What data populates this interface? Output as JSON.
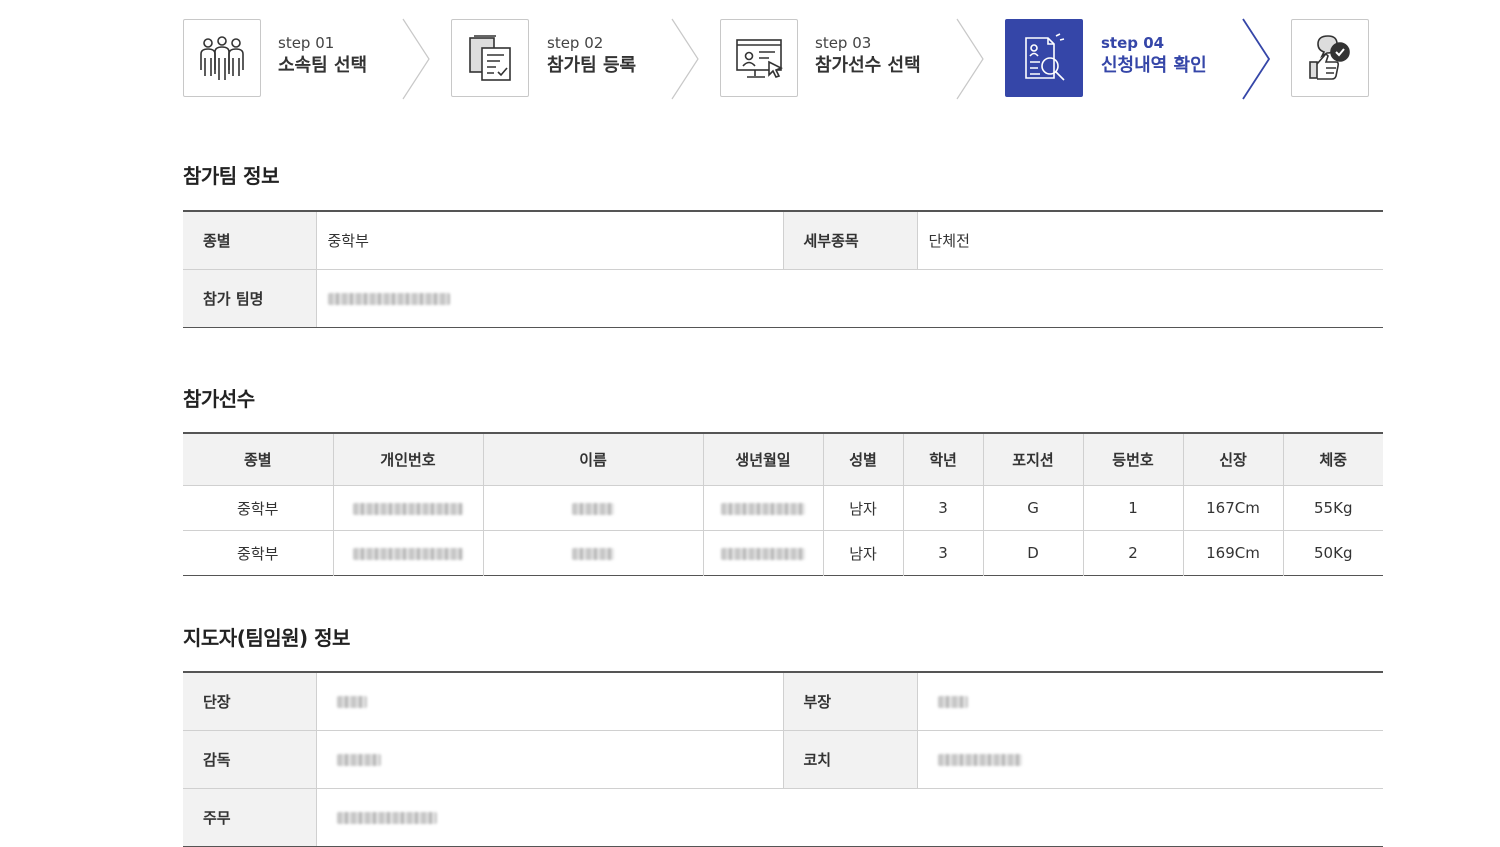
{
  "steps": [
    {
      "num": "step 01",
      "title": "소속팀 선택",
      "icon": "team-people-icon",
      "active": false
    },
    {
      "num": "step 02",
      "title": "참가팀 등록",
      "icon": "document-checklist-icon",
      "active": false
    },
    {
      "num": "step 03",
      "title": "참가선수 선택",
      "icon": "monitor-cursor-icon",
      "active": false
    },
    {
      "num": "step 04",
      "title": "신청내역 확인",
      "icon": "document-search-icon",
      "active": true
    },
    {
      "num": "",
      "title": "",
      "icon": "thumbs-up-check-icon",
      "active": false
    }
  ],
  "team_info": {
    "title": "참가팀 정보",
    "category_label": "종별",
    "category_value": "중학부",
    "event_label": "세부종목",
    "event_value": "단체전",
    "team_name_label": "참가 팀명"
  },
  "players": {
    "title": "참가선수",
    "headers": [
      "종별",
      "개인번호",
      "이름",
      "생년월일",
      "성별",
      "학년",
      "포지션",
      "등번호",
      "신장",
      "체중"
    ],
    "rows": [
      {
        "category": "중학부",
        "gender": "남자",
        "grade": "3",
        "position": "G",
        "number": "1",
        "height": "167Cm",
        "weight": "55Kg"
      },
      {
        "category": "중학부",
        "gender": "남자",
        "grade": "3",
        "position": "D",
        "number": "2",
        "height": "169Cm",
        "weight": "50Kg"
      }
    ]
  },
  "staff": {
    "title": "지도자(팀임원) 정보",
    "leader_label": "단장",
    "deputy_label": "부장",
    "director_label": "감독",
    "coach_label": "코치",
    "next_label": "주무"
  },
  "colors": {
    "accent": "#3546a8",
    "header_bg": "#f2f2f2",
    "border": "#d0d0d0"
  }
}
